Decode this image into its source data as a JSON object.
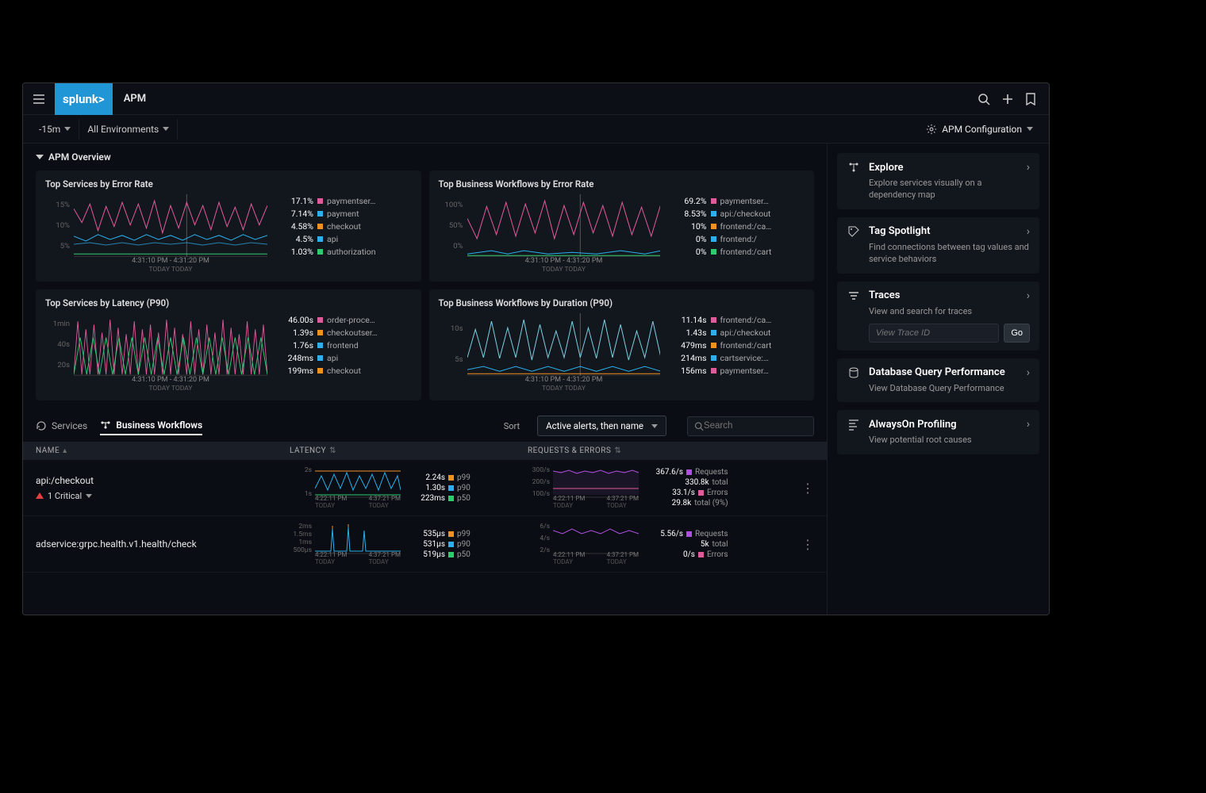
{
  "header": {
    "logo": "splunk>",
    "app_name": "APM"
  },
  "toolbar": {
    "time_range": "-15m",
    "environments": "All Environments",
    "config": "APM Configuration"
  },
  "overview": {
    "title": "APM Overview"
  },
  "cards": {
    "err_services": {
      "title": "Top Services by Error Rate",
      "y_ticks": [
        "15%",
        "10%",
        "5%"
      ],
      "x_time": "4:31:10 PM - 4:31:20 PM",
      "x_sub": "TODAY   TODAY",
      "legend": [
        {
          "value": "17.1%",
          "color": "#e05a9c",
          "name": "paymentser…"
        },
        {
          "value": "7.14%",
          "color": "#2ab0ed",
          "name": "payment"
        },
        {
          "value": "4.58%",
          "color": "#f29020",
          "name": "checkout"
        },
        {
          "value": "4.5%",
          "color": "#2ab0ed",
          "name": "api"
        },
        {
          "value": "1.03%",
          "color": "#2ecc71",
          "name": "authorization"
        }
      ]
    },
    "err_workflows": {
      "title": "Top Business Workflows by Error Rate",
      "y_ticks": [
        "100%",
        "50%",
        "0%"
      ],
      "x_time": "4:31:10 PM - 4:31:20 PM",
      "x_sub": "TODAY   TODAY",
      "legend": [
        {
          "value": "69.2%",
          "color": "#e05a9c",
          "name": "paymentser…"
        },
        {
          "value": "8.53%",
          "color": "#2ab0ed",
          "name": "api:/checkout"
        },
        {
          "value": "10%",
          "color": "#f29020",
          "name": "frontend:/ca…"
        },
        {
          "value": "0%",
          "color": "#2ab0ed",
          "name": "frontend:/"
        },
        {
          "value": "0%",
          "color": "#2ecc71",
          "name": "frontend:/cart"
        }
      ]
    },
    "lat_services": {
      "title": "Top Services by Latency (P90)",
      "y_ticks": [
        "1min",
        "40s",
        "20s"
      ],
      "x_time": "4:31:10 PM - 4:31:20 PM",
      "x_sub": "TODAY   TODAY",
      "legend": [
        {
          "value": "46.00s",
          "color": "#e05a9c",
          "name": "order-proce…"
        },
        {
          "value": "1.39s",
          "color": "#f29020",
          "name": "checkoutser…"
        },
        {
          "value": "1.76s",
          "color": "#2ab0ed",
          "name": "frontend"
        },
        {
          "value": "248ms",
          "color": "#2ab0ed",
          "name": "api"
        },
        {
          "value": "199ms",
          "color": "#f29020",
          "name": "checkout"
        }
      ]
    },
    "dur_workflows": {
      "title": "Top Business Workflows by Duration (P90)",
      "y_ticks": [
        "10s",
        "5s"
      ],
      "x_time": "4:31:10 PM - 4:31:20 PM",
      "x_sub": "TODAY   TODAY",
      "legend": [
        {
          "value": "11.14s",
          "color": "#e05a9c",
          "name": "frontend:/ca…"
        },
        {
          "value": "1.43s",
          "color": "#2ab0ed",
          "name": "api:/checkout"
        },
        {
          "value": "479ms",
          "color": "#f29020",
          "name": "frontend:/cart"
        },
        {
          "value": "214ms",
          "color": "#2ab0ed",
          "name": "cartservice:…"
        },
        {
          "value": "156ms",
          "color": "#e05a9c",
          "name": "paymentser…"
        }
      ]
    }
  },
  "tabs": {
    "services": "Services",
    "workflows": "Business Workflows",
    "sort_label": "Sort",
    "sort_value": "Active alerts, then name",
    "search_placeholder": "Search"
  },
  "table": {
    "columns": {
      "name": "NAME",
      "latency": "LATENCY",
      "req": "REQUESTS & ERRORS"
    },
    "rows": [
      {
        "name": "api:/checkout",
        "alert": "1 Critical",
        "latency_ticks": [
          "2s",
          "1s"
        ],
        "latency_x": [
          "4:22:11 PM",
          "4:37:21 PM"
        ],
        "latency_sub": "TODAY",
        "latency_stats": [
          {
            "val": "2.24s",
            "color": "#f29020",
            "lbl": "p99"
          },
          {
            "val": "1.30s",
            "color": "#2ab0ed",
            "lbl": "p90"
          },
          {
            "val": "223ms",
            "color": "#2ecc71",
            "lbl": "p50"
          }
        ],
        "req_ticks": [
          "300/s",
          "200/s",
          "100/s"
        ],
        "req_x": [
          "4:22:11 PM",
          "4:37:21 PM"
        ],
        "req_stats": [
          {
            "val": "367.6/s",
            "color": "#b050e0",
            "lbl": "Requests"
          },
          {
            "val": "330.8k",
            "color": "",
            "lbl": "total"
          },
          {
            "val": "33.1/s",
            "color": "#e05a9c",
            "lbl": "Errors"
          },
          {
            "val": "29.8k",
            "color": "",
            "lbl": "total (9%)"
          }
        ]
      },
      {
        "name": "adservice:grpc.health.v1.health/check",
        "latency_ticks": [
          "2ms",
          "1.5ms",
          "1ms",
          "500µs"
        ],
        "latency_x": [
          "4:22:11 PM",
          "4:37:21 PM"
        ],
        "latency_sub": "TODAY",
        "latency_stats": [
          {
            "val": "535µs",
            "color": "#f29020",
            "lbl": "p99"
          },
          {
            "val": "531µs",
            "color": "#2ab0ed",
            "lbl": "p90"
          },
          {
            "val": "519µs",
            "color": "#2ecc71",
            "lbl": "p50"
          }
        ],
        "req_ticks": [
          "6/s",
          "4/s",
          "2/s"
        ],
        "req_x": [
          "4:22:11 PM",
          "4:37:21 PM"
        ],
        "req_stats": [
          {
            "val": "5.56/s",
            "color": "#b050e0",
            "lbl": "Requests"
          },
          {
            "val": "5k",
            "color": "",
            "lbl": "total"
          },
          {
            "val": "0/s",
            "color": "#e05a9c",
            "lbl": "Errors"
          }
        ]
      }
    ]
  },
  "sidebar": {
    "explore": {
      "title": "Explore",
      "desc": "Explore services visually on a dependency map"
    },
    "tag": {
      "title": "Tag Spotlight",
      "desc": "Find connections between tag values and service behaviors"
    },
    "traces": {
      "title": "Traces",
      "desc": "View and search for traces",
      "placeholder": "View Trace ID",
      "go": "Go"
    },
    "db": {
      "title": "Database Query Performance",
      "desc": "View Database Query Performance"
    },
    "profiling": {
      "title": "AlwaysOn Profiling",
      "desc": "View potential root causes"
    }
  },
  "chart_data": [
    {
      "id": "err_services",
      "type": "line",
      "title": "Top Services by Error Rate",
      "ylabel": "%",
      "ylim": [
        0,
        20
      ],
      "x": "4:31:10 PM - 4:31:20 PM",
      "series": [
        {
          "name": "paymentservice",
          "approx_value": 17.1
        },
        {
          "name": "payment",
          "approx_value": 7.14
        },
        {
          "name": "checkout",
          "approx_value": 4.58
        },
        {
          "name": "api",
          "approx_value": 4.5
        },
        {
          "name": "authorization",
          "approx_value": 1.03
        }
      ]
    },
    {
      "id": "err_workflows",
      "type": "line",
      "title": "Top Business Workflows by Error Rate",
      "ylabel": "%",
      "ylim": [
        0,
        100
      ],
      "x": "4:31:10 PM - 4:31:20 PM",
      "series": [
        {
          "name": "paymentser…",
          "approx_value": 69.2
        },
        {
          "name": "api:/checkout",
          "approx_value": 8.53
        },
        {
          "name": "frontend:/ca…",
          "approx_value": 10
        },
        {
          "name": "frontend:/",
          "approx_value": 0
        },
        {
          "name": "frontend:/cart",
          "approx_value": 0
        }
      ]
    },
    {
      "id": "lat_services",
      "type": "line",
      "title": "Top Services by Latency (P90)",
      "ylabel": "seconds",
      "ylim": [
        0,
        60
      ],
      "x": "4:31:10 PM - 4:31:20 PM",
      "series": [
        {
          "name": "order-processing",
          "approx_value": 46.0
        },
        {
          "name": "checkoutservice",
          "approx_value": 1.39
        },
        {
          "name": "frontend",
          "approx_value": 1.76
        },
        {
          "name": "api",
          "approx_value": 0.248
        },
        {
          "name": "checkout",
          "approx_value": 0.199
        }
      ]
    },
    {
      "id": "dur_workflows",
      "type": "line",
      "title": "Top Business Workflows by Duration (P90)",
      "ylabel": "seconds",
      "ylim": [
        0,
        12
      ],
      "x": "4:31:10 PM - 4:31:20 PM",
      "series": [
        {
          "name": "frontend:/ca…",
          "approx_value": 11.14
        },
        {
          "name": "api:/checkout",
          "approx_value": 1.43
        },
        {
          "name": "frontend:/cart",
          "approx_value": 0.479
        },
        {
          "name": "cartservice:…",
          "approx_value": 0.214
        },
        {
          "name": "paymentser…",
          "approx_value": 0.156
        }
      ]
    }
  ]
}
